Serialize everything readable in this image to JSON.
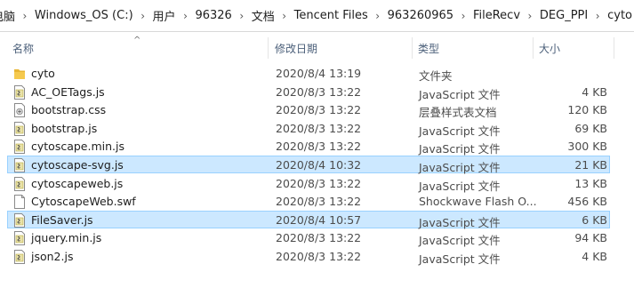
{
  "breadcrumb": [
    "电脑",
    "Windows_OS (C:)",
    "用户",
    "96326",
    "文档",
    "Tencent Files",
    "963260965",
    "FileRecv",
    "DEG_PPI",
    "cyto"
  ],
  "columns": {
    "name": "名称",
    "date": "修改日期",
    "type": "类型",
    "size": "大小"
  },
  "files": [
    {
      "name": "cyto",
      "date": "2020/8/4 13:19",
      "type": "文件夹",
      "size": "",
      "icon": "folder-icon",
      "selected": false
    },
    {
      "name": "AC_OETags.js",
      "date": "2020/8/3 13:22",
      "type": "JavaScript 文件",
      "size": "4 KB",
      "icon": "javascript-file-icon",
      "selected": false
    },
    {
      "name": "bootstrap.css",
      "date": "2020/8/3 13:22",
      "type": "层叠样式表文档",
      "size": "120 KB",
      "icon": "css-file-icon",
      "selected": false
    },
    {
      "name": "bootstrap.js",
      "date": "2020/8/3 13:22",
      "type": "JavaScript 文件",
      "size": "69 KB",
      "icon": "javascript-file-icon",
      "selected": false
    },
    {
      "name": "cytoscape.min.js",
      "date": "2020/8/3 13:22",
      "type": "JavaScript 文件",
      "size": "300 KB",
      "icon": "javascript-file-icon",
      "selected": false
    },
    {
      "name": "cytoscape-svg.js",
      "date": "2020/8/4 10:32",
      "type": "JavaScript 文件",
      "size": "21 KB",
      "icon": "javascript-file-icon",
      "selected": true
    },
    {
      "name": "cytoscapeweb.js",
      "date": "2020/8/3 13:22",
      "type": "JavaScript 文件",
      "size": "13 KB",
      "icon": "javascript-file-icon",
      "selected": false
    },
    {
      "name": "CytoscapeWeb.swf",
      "date": "2020/8/3 13:22",
      "type": "Shockwave Flash O...",
      "size": "456 KB",
      "icon": "blank-file-icon",
      "selected": false
    },
    {
      "name": "FileSaver.js",
      "date": "2020/8/4 10:57",
      "type": "JavaScript 文件",
      "size": "6 KB",
      "icon": "javascript-file-icon",
      "selected": true
    },
    {
      "name": "jquery.min.js",
      "date": "2020/8/3 13:22",
      "type": "JavaScript 文件",
      "size": "94 KB",
      "icon": "javascript-file-icon",
      "selected": false
    },
    {
      "name": "json2.js",
      "date": "2020/8/3 13:22",
      "type": "JavaScript 文件",
      "size": "4 KB",
      "icon": "javascript-file-icon",
      "selected": false
    }
  ],
  "colors": {
    "selection_bg": "#cce8ff",
    "selection_border": "#99d1ff",
    "folder": "#e8b533",
    "header_text": "#4c607a"
  }
}
